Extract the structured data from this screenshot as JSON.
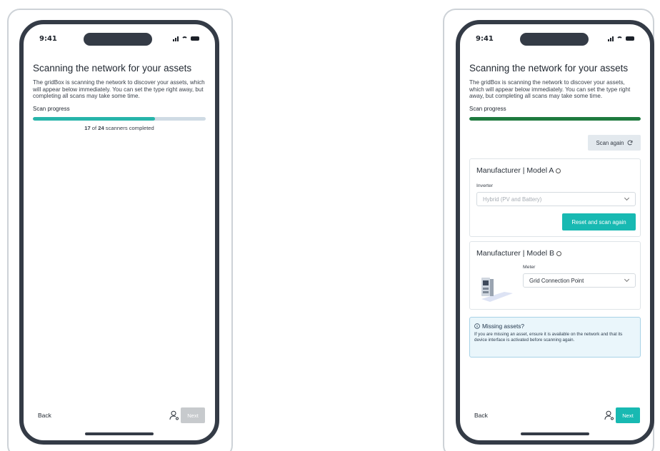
{
  "colors": {
    "accent": "#18b9b2",
    "progress_active": "#27b5aa",
    "progress_done": "#1f7a3f",
    "frame": "#343b46"
  },
  "left_screen": {
    "time": "9:41",
    "title": "Scanning the network for your assets",
    "description": "The gridBox is scanning the network to discover your assets, which will appear below immediately. You can set the type right away, but completing all scans may take some time.",
    "progress_label": "Scan progress",
    "progress_fraction": 0.708,
    "completed": "17",
    "of": " of ",
    "total": "24",
    "scanners_suffix": " scanners completed",
    "back": "Back",
    "next": "Next"
  },
  "right_screen": {
    "time": "9:41",
    "title": "Scanning the network for your assets",
    "description": "The gridBox is scanning the network to discover your assets, which will appear below immediately. You can set the type right away, but completing all scans may take some time.",
    "progress_label": "Scan progress",
    "progress_fraction": 1.0,
    "scan_again": "Scan again",
    "asset_a": {
      "title": "Manufacturer | Model A",
      "field_label": "Inverter",
      "select_value": "Hybrid (PV and Battery)",
      "reset_button": "Reset and scan again"
    },
    "asset_b": {
      "title": "Manufacturer | Model B",
      "field_label": "Meter",
      "select_value": "Grid Connection Point"
    },
    "notice": {
      "title": "Missing assets?",
      "text": "If you are missing an asset, ensure it is available on the network and that its device interface is activated before scanning again."
    },
    "back": "Back",
    "next": "Next"
  }
}
